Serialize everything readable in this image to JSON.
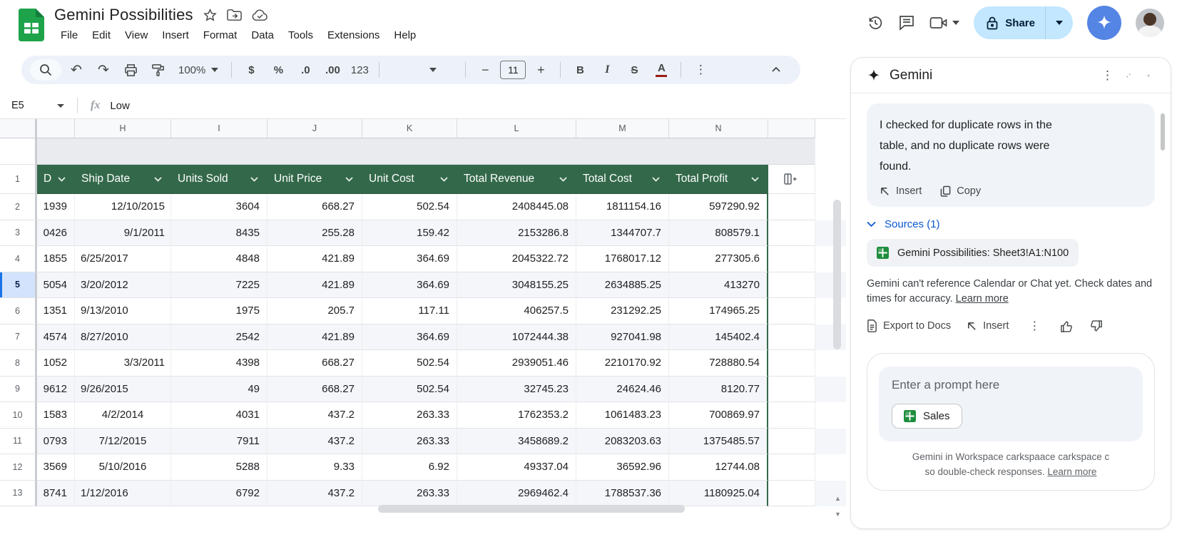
{
  "titlebar": {
    "title": "Gemini Possibilities",
    "menus": [
      "File",
      "Edit",
      "View",
      "Insert",
      "Format",
      "Data",
      "Tools",
      "Extensions",
      "Help"
    ],
    "share_label": "Share"
  },
  "toolbar": {
    "zoom": "100%",
    "font_size": "11",
    "currency": "$",
    "percent": "%",
    "decimal_decrease": ".0",
    "decimal_increase": ".00",
    "more_formats": "123",
    "bold": "B",
    "italic": "I",
    "strikethrough": "S",
    "text_color": "A"
  },
  "formula_bar": {
    "name_box": "E5",
    "value": "Low"
  },
  "grid": {
    "column_letters": [
      "H",
      "I",
      "J",
      "K",
      "L",
      "M",
      "N"
    ],
    "header": {
      "partial_label": "D",
      "columns": [
        "Ship Date",
        "Units Sold",
        "Unit Price",
        "Unit Cost",
        "Total Revenue",
        "Total Cost",
        "Total Profit"
      ]
    },
    "selected_row": 5,
    "rows": [
      {
        "row_num": 2,
        "order_id_fragment": "1939",
        "ship_date": "12/10/2015",
        "date_align": "right",
        "units_sold": "3604",
        "unit_price": "668.27",
        "unit_cost": "502.54",
        "total_revenue": "2408445.08",
        "total_cost": "1811154.16",
        "total_profit": "597290.92"
      },
      {
        "row_num": 3,
        "order_id_fragment": "0426",
        "ship_date": "9/1/2011",
        "date_align": "right",
        "units_sold": "8435",
        "unit_price": "255.28",
        "unit_cost": "159.42",
        "total_revenue": "2153286.8",
        "total_cost": "1344707.7",
        "total_profit": "808579.1"
      },
      {
        "row_num": 4,
        "order_id_fragment": "1855",
        "ship_date": "6/25/2017",
        "date_align": "left",
        "units_sold": "4848",
        "unit_price": "421.89",
        "unit_cost": "364.69",
        "total_revenue": "2045322.72",
        "total_cost": "1768017.12",
        "total_profit": "277305.6"
      },
      {
        "row_num": 5,
        "order_id_fragment": "5054",
        "ship_date": "3/20/2012",
        "date_align": "left",
        "units_sold": "7225",
        "unit_price": "421.89",
        "unit_cost": "364.69",
        "total_revenue": "3048155.25",
        "total_cost": "2634885.25",
        "total_profit": "413270"
      },
      {
        "row_num": 6,
        "order_id_fragment": "1351",
        "ship_date": "9/13/2010",
        "date_align": "left",
        "units_sold": "1975",
        "unit_price": "205.7",
        "unit_cost": "117.11",
        "total_revenue": "406257.5",
        "total_cost": "231292.25",
        "total_profit": "174965.25"
      },
      {
        "row_num": 7,
        "order_id_fragment": "4574",
        "ship_date": "8/27/2010",
        "date_align": "left",
        "units_sold": "2542",
        "unit_price": "421.89",
        "unit_cost": "364.69",
        "total_revenue": "1072444.38",
        "total_cost": "927041.98",
        "total_profit": "145402.4"
      },
      {
        "row_num": 8,
        "order_id_fragment": "1052",
        "ship_date": "3/3/2011",
        "date_align": "right",
        "units_sold": "4398",
        "unit_price": "668.27",
        "unit_cost": "502.54",
        "total_revenue": "2939051.46",
        "total_cost": "2210170.92",
        "total_profit": "728880.54"
      },
      {
        "row_num": 9,
        "order_id_fragment": "9612",
        "ship_date": "9/26/2015",
        "date_align": "left",
        "units_sold": "49",
        "unit_price": "668.27",
        "unit_cost": "502.54",
        "total_revenue": "32745.23",
        "total_cost": "24624.46",
        "total_profit": "8120.77"
      },
      {
        "row_num": 10,
        "order_id_fragment": "1583",
        "ship_date": "4/2/2014",
        "date_align": "center",
        "units_sold": "4031",
        "unit_price": "437.2",
        "unit_cost": "263.33",
        "total_revenue": "1762353.2",
        "total_cost": "1061483.23",
        "total_profit": "700869.97"
      },
      {
        "row_num": 11,
        "order_id_fragment": "0793",
        "ship_date": "7/12/2015",
        "date_align": "center",
        "units_sold": "7911",
        "unit_price": "437.2",
        "unit_cost": "263.33",
        "total_revenue": "3458689.2",
        "total_cost": "2083203.63",
        "total_profit": "1375485.57"
      },
      {
        "row_num": 12,
        "order_id_fragment": "3569",
        "ship_date": "5/10/2016",
        "date_align": "center",
        "units_sold": "5288",
        "unit_price": "9.33",
        "unit_cost": "6.92",
        "total_revenue": "49337.04",
        "total_cost": "36592.96",
        "total_profit": "12744.08"
      },
      {
        "row_num": 13,
        "order_id_fragment": "8741",
        "ship_date": "1/12/2016",
        "date_align": "left",
        "units_sold": "6792",
        "unit_price": "437.2",
        "unit_cost": "263.33",
        "total_revenue": "2969462.4",
        "total_cost": "1788537.36",
        "total_profit": "1180925.04"
      }
    ]
  },
  "panel": {
    "title": "Gemini",
    "response": "I checked for duplicate rows in the table, and no duplicate rows were found.",
    "insert_label": "Insert",
    "copy_label": "Copy",
    "sources_label": "Sources (1)",
    "source_chip": "Gemini Possibilities: Sheet3!A1:N100",
    "notice": "Gemini can't reference Calendar or Chat yet. Check dates and times for accuracy.",
    "notice_link": "Learn more",
    "export_label": "Export to Docs",
    "insert_label2": "Insert",
    "prompt_placeholder": "Enter a prompt here",
    "context_chip": "Sales",
    "footer_line1": "Gemini in Workspace carkspaace carkspace c",
    "footer_line2": "so double-check responses.",
    "footer_link": "Learn more"
  },
  "icons": [
    "sheets-logo",
    "star-icon",
    "move-folder-icon",
    "cloud-saved-icon",
    "history-icon",
    "comments-icon",
    "video-call-icon",
    "lock-icon",
    "gemini-spark-icon",
    "search-icon",
    "undo-icon",
    "redo-icon",
    "print-icon",
    "paint-format-icon",
    "more-vertical-icon",
    "collapse-toolbar-icon",
    "fx-icon",
    "column-dropdown-icon",
    "add-column-icon",
    "expand-icon",
    "close-icon",
    "insert-arrow-icon",
    "copy-icon",
    "export-docs-icon",
    "thumb-up-icon",
    "thumb-down-icon",
    "sheets-mini-icon"
  ]
}
